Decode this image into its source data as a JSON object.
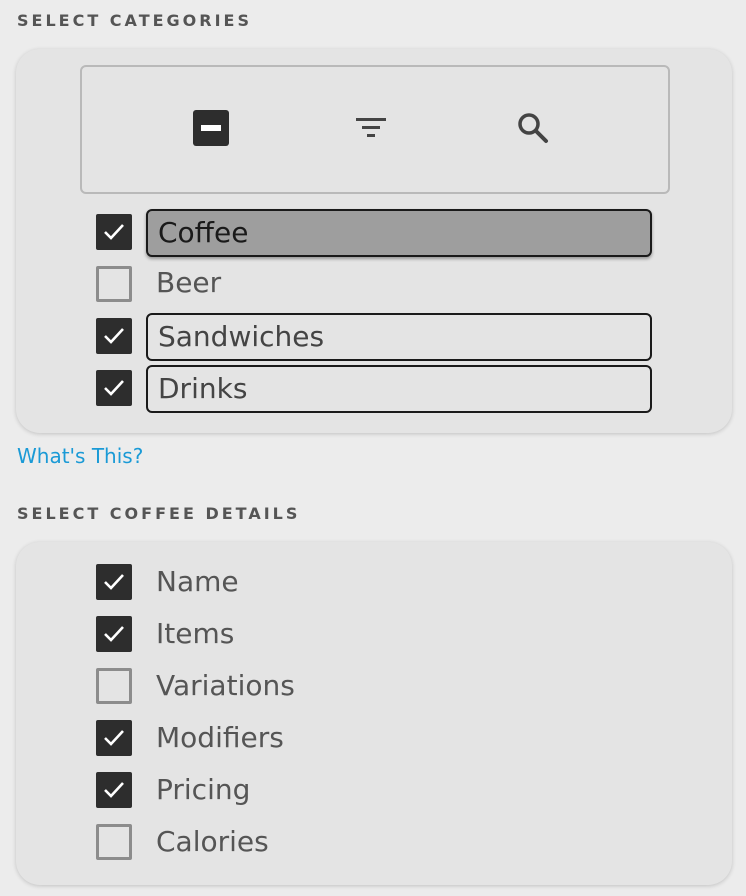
{
  "categories_section": {
    "title": "SELECT CATEGORIES",
    "toolbar": {
      "icons": [
        "deselect-all-icon",
        "filter-icon",
        "search-icon"
      ]
    },
    "items": [
      {
        "label": "Coffee",
        "checked": true,
        "highlighted": true
      },
      {
        "label": "Beer",
        "checked": false,
        "highlighted": false
      },
      {
        "label": "Sandwiches",
        "checked": true,
        "highlighted": false
      },
      {
        "label": "Drinks",
        "checked": true,
        "highlighted": false
      }
    ]
  },
  "help_link": {
    "label": "What's This?"
  },
  "details_section": {
    "title": "SELECT COFFEE DETAILS",
    "items": [
      {
        "label": "Name",
        "checked": true
      },
      {
        "label": "Items",
        "checked": true
      },
      {
        "label": "Variations",
        "checked": false
      },
      {
        "label": "Modifiers",
        "checked": true
      },
      {
        "label": "Pricing",
        "checked": true
      },
      {
        "label": "Calories",
        "checked": false
      }
    ]
  },
  "colors": {
    "checkbox_checked": "#2d2d2d",
    "checkbox_unchecked_border": "#8c8c8c",
    "highlight": "#9e9e9e",
    "link": "#1a9ad6"
  }
}
